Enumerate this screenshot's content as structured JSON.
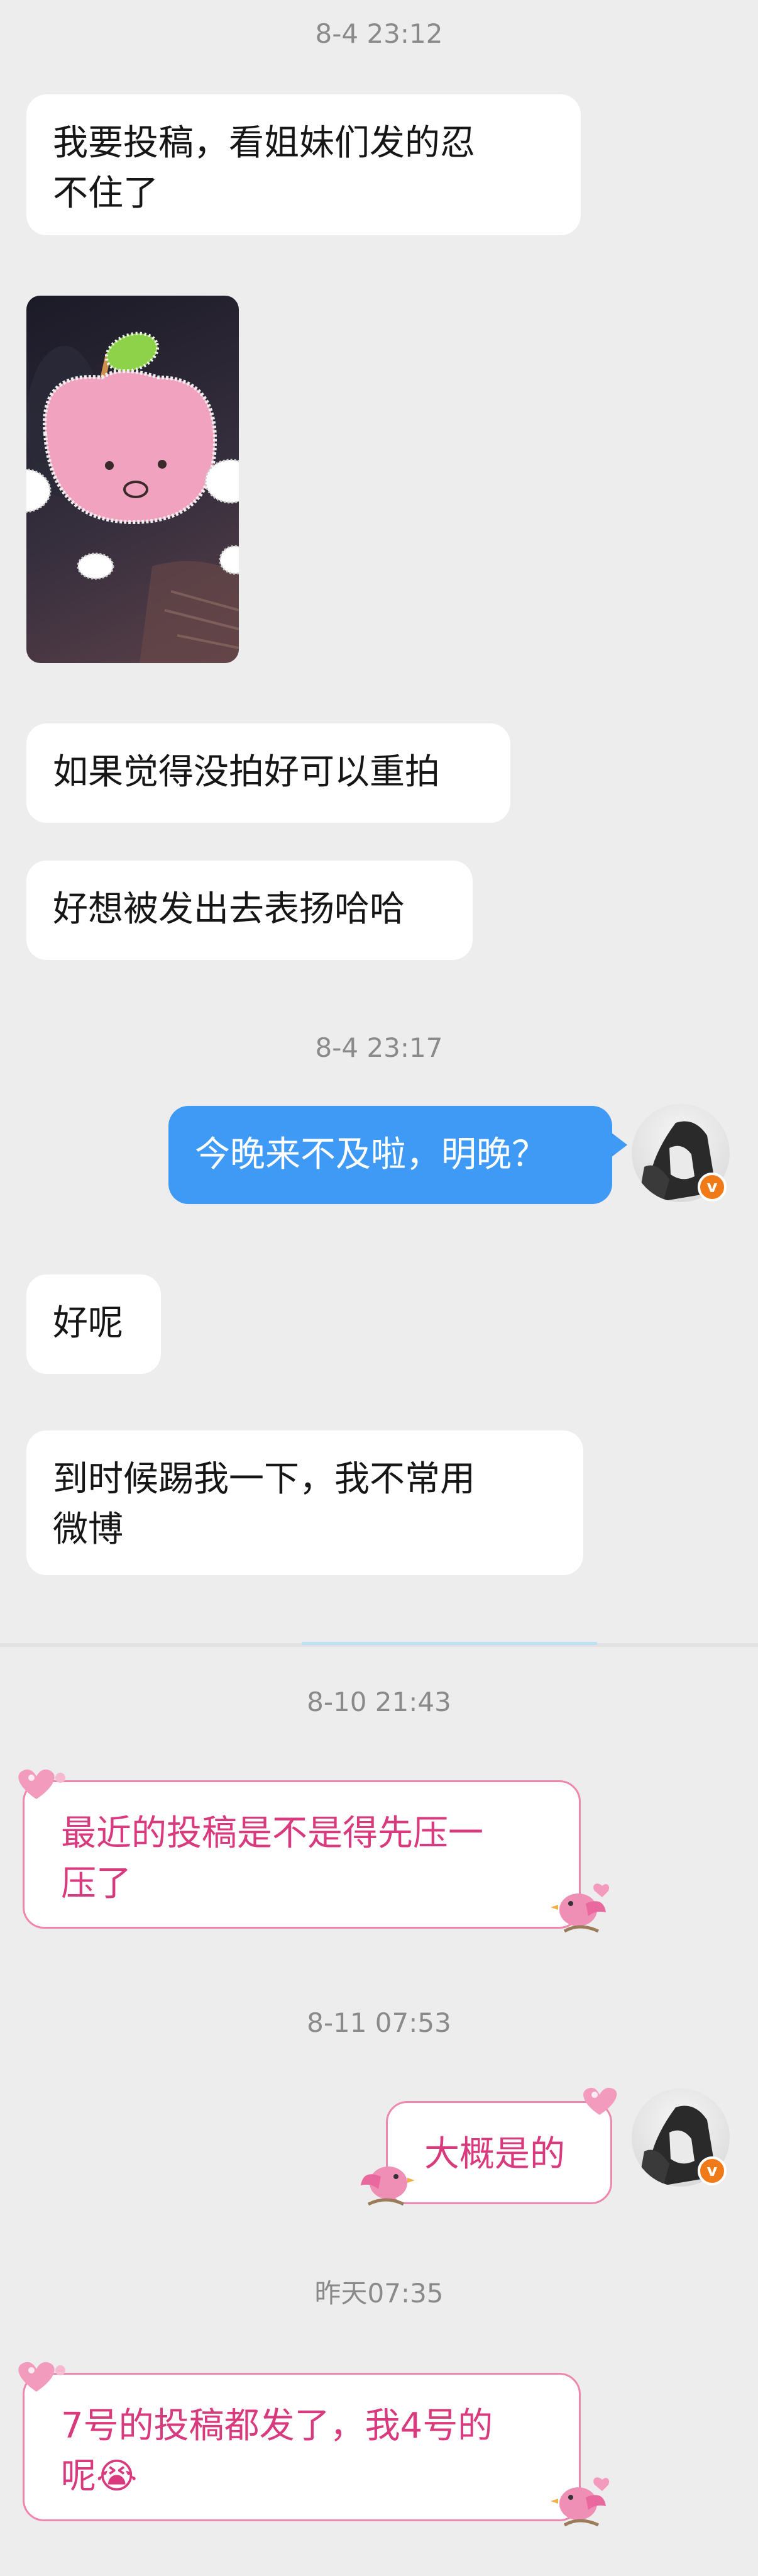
{
  "messages": {
    "ts1": "8-4 23:12",
    "m1": "我要投稿，看姐妹们发的忍",
    "m1b": "不住了",
    "m2": "如果觉得没拍好可以重拍",
    "m3": "好想被发出去表扬哈哈",
    "ts2": "8-4 23:17",
    "m4": "今晚来不及啦，明晚？",
    "m5": "好呢",
    "m6": "到时候踢我一下，我不常用",
    "m6b": "微博",
    "ts3": "8-10 21:43",
    "m7": "最近的投稿是不是得先压一",
    "m7b": "压了",
    "ts4": "8-11 07:53",
    "m8": "大概是的",
    "ts5": "昨天07:35",
    "m9": "7号的投稿都发了，我4号的",
    "m9b": "呢😭"
  },
  "avatar_badge": "v",
  "colors": {
    "background": "#ededed",
    "incoming_bubble": "#ffffff",
    "outgoing_bubble": "#3e9af4",
    "pink_bubble_border": "#ef86ad",
    "pink_bubble_text": "#d93a7d",
    "timestamp": "#8a8a8a",
    "badge": "#f07a18"
  }
}
